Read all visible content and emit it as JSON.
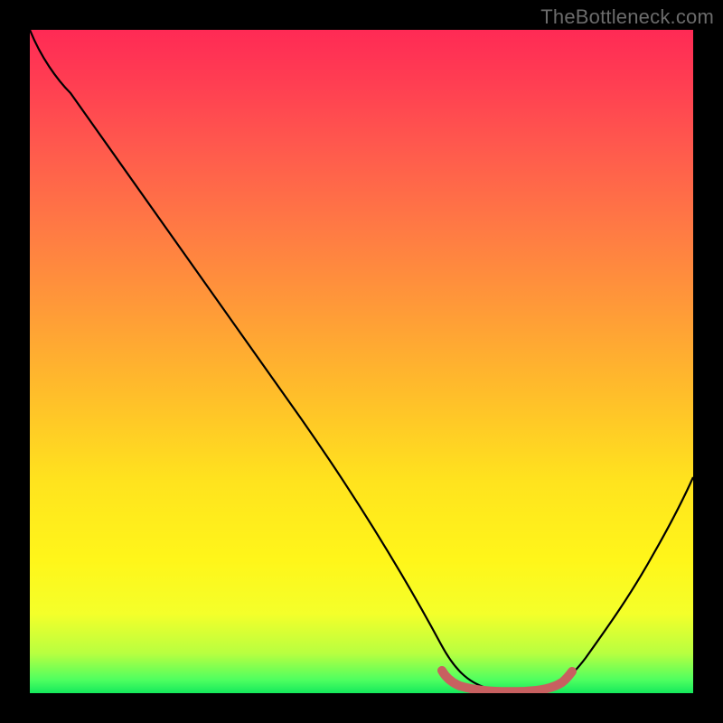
{
  "watermark": "TheBottleneck.com",
  "chart_data": {
    "type": "line",
    "title": "",
    "xlabel": "",
    "ylabel": "",
    "xlim": [
      0,
      100
    ],
    "ylim": [
      0,
      100
    ],
    "series": [
      {
        "name": "bottleneck-curve",
        "x": [
          0,
          5,
          10,
          20,
          30,
          40,
          50,
          60,
          63,
          67,
          72,
          77,
          80,
          85,
          90,
          95,
          100
        ],
        "y": [
          100,
          95,
          91,
          79,
          65,
          51,
          37,
          20,
          10,
          4,
          1,
          0.5,
          1,
          5,
          15,
          28,
          41
        ]
      },
      {
        "name": "optimal-region",
        "x": [
          63,
          67,
          72,
          77,
          80
        ],
        "y": [
          2,
          1,
          0.5,
          0.5,
          1.5
        ]
      }
    ],
    "colors": {
      "curve": "#000000",
      "optimal_marker": "#c86060",
      "gradient_top": "#ff2a55",
      "gradient_bottom": "#14e95c"
    }
  }
}
